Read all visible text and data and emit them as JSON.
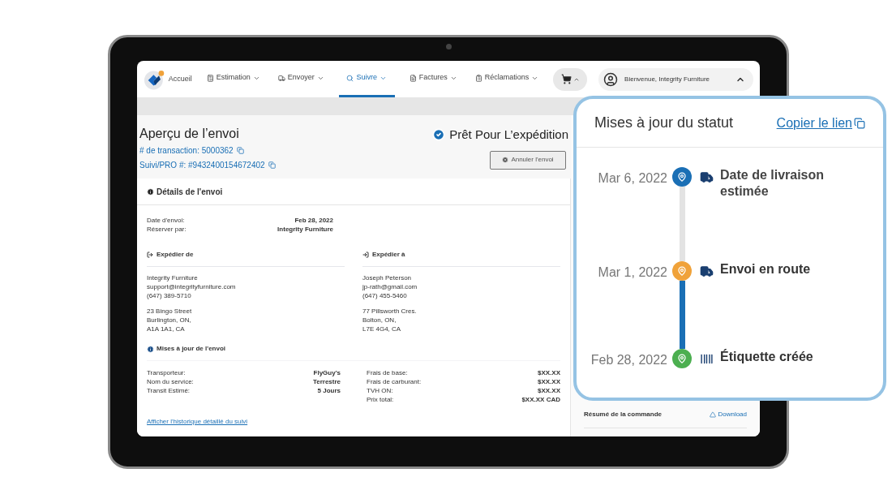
{
  "nav": {
    "home": "Accueil",
    "items": [
      {
        "label": "Estimation",
        "kind": "calculator",
        "selected": false
      },
      {
        "label": "Envoyer",
        "kind": "truck",
        "selected": false
      },
      {
        "label": "Suivre",
        "kind": "search",
        "selected": true
      },
      {
        "label": "Factures",
        "kind": "file",
        "selected": false
      },
      {
        "label": "Réclamations",
        "kind": "clipboard",
        "selected": false
      }
    ],
    "user": "Bienvenue, Integrity Furniture"
  },
  "header": {
    "title": "Aperçu de l’envoi",
    "transaction": "# de transaction: 5000362",
    "tracking": "Suivi/PRO #: #9432400154672402",
    "status": "Prêt Pour L’expédition",
    "cancel": "Annuler l'envoi"
  },
  "details": {
    "title": "Détails de l'envoi",
    "summary": [
      {
        "label": "Date d'envoi:",
        "value": "Feb 28, 2022"
      },
      {
        "label": "Réserver par:",
        "value": "Integrity Furniture"
      }
    ],
    "from": {
      "title": "Expédier de",
      "contact": [
        "Integrity Furniture",
        "support@integrityfurniture.com",
        "(647) 389-5710"
      ],
      "address": [
        "23 Bingo Street",
        "Burlington, ON,",
        "A1A 1A1, CA"
      ]
    },
    "to": {
      "title": "Expédier à",
      "contact": [
        "Joseph Peterson",
        "jp-rath@gmail.com",
        "(647) 455-5460"
      ],
      "address": [
        "77 Pillsworth Cres.",
        "Bolton, ON,",
        "L7E 4G4, CA"
      ]
    },
    "updates_title": "Mises à jour de l'envoi",
    "service": [
      {
        "label": "Transporteur:",
        "value": "FlyGuy's"
      },
      {
        "label": "Nom du service:",
        "value": "Terrestre"
      },
      {
        "label": "Transit Estimé:",
        "value": "5 Jours"
      }
    ],
    "charges": [
      {
        "label": "Frais de base:",
        "value": "$XX.XX"
      },
      {
        "label": "Frais de carburant:",
        "value": "$XX.XX"
      },
      {
        "label": "TVH ON:",
        "value": "$XX.XX"
      },
      {
        "label": "Prix total:",
        "value": "$XX.XX CAD"
      }
    ],
    "history_link": "Afficher l'historique détaillé du suivi"
  },
  "order_summary": {
    "title": "Résumé de la commande",
    "download": "Download"
  },
  "status_updates": {
    "title": "Mises à jour du statut",
    "copy_link": "Copier le lien",
    "events": [
      {
        "date": "Mar 6, 2022",
        "label": "Date de livraison estimée",
        "kind": "truck",
        "color": "#1a6fb5",
        "reached": false
      },
      {
        "date": "Mar 1, 2022",
        "label": "Envoi en route",
        "kind": "truck",
        "color": "#f0a23a",
        "reached": true
      },
      {
        "date": "Feb 28, 2022",
        "label": "Étiquette créée",
        "kind": "label",
        "color": "#4caf50",
        "reached": true
      }
    ]
  }
}
